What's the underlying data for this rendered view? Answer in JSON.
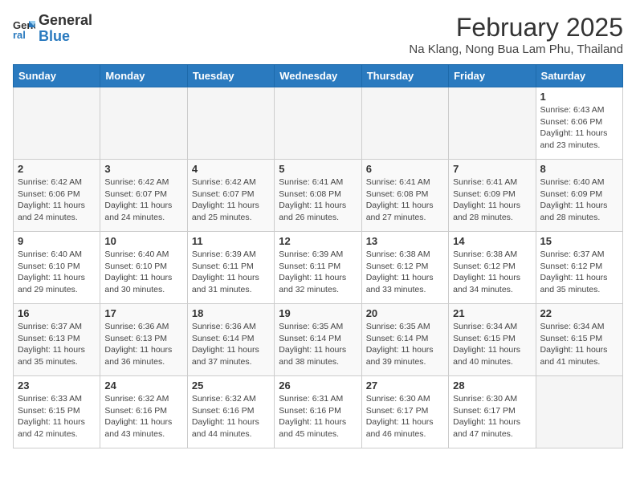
{
  "header": {
    "logo_general": "General",
    "logo_blue": "Blue",
    "month_year": "February 2025",
    "location": "Na Klang, Nong Bua Lam Phu, Thailand"
  },
  "weekdays": [
    "Sunday",
    "Monday",
    "Tuesday",
    "Wednesday",
    "Thursday",
    "Friday",
    "Saturday"
  ],
  "weeks": [
    [
      {
        "day": "",
        "info": ""
      },
      {
        "day": "",
        "info": ""
      },
      {
        "day": "",
        "info": ""
      },
      {
        "day": "",
        "info": ""
      },
      {
        "day": "",
        "info": ""
      },
      {
        "day": "",
        "info": ""
      },
      {
        "day": "1",
        "info": "Sunrise: 6:43 AM\nSunset: 6:06 PM\nDaylight: 11 hours and 23 minutes."
      }
    ],
    [
      {
        "day": "2",
        "info": "Sunrise: 6:42 AM\nSunset: 6:06 PM\nDaylight: 11 hours and 24 minutes."
      },
      {
        "day": "3",
        "info": "Sunrise: 6:42 AM\nSunset: 6:07 PM\nDaylight: 11 hours and 24 minutes."
      },
      {
        "day": "4",
        "info": "Sunrise: 6:42 AM\nSunset: 6:07 PM\nDaylight: 11 hours and 25 minutes."
      },
      {
        "day": "5",
        "info": "Sunrise: 6:41 AM\nSunset: 6:08 PM\nDaylight: 11 hours and 26 minutes."
      },
      {
        "day": "6",
        "info": "Sunrise: 6:41 AM\nSunset: 6:08 PM\nDaylight: 11 hours and 27 minutes."
      },
      {
        "day": "7",
        "info": "Sunrise: 6:41 AM\nSunset: 6:09 PM\nDaylight: 11 hours and 28 minutes."
      },
      {
        "day": "8",
        "info": "Sunrise: 6:40 AM\nSunset: 6:09 PM\nDaylight: 11 hours and 28 minutes."
      }
    ],
    [
      {
        "day": "9",
        "info": "Sunrise: 6:40 AM\nSunset: 6:10 PM\nDaylight: 11 hours and 29 minutes."
      },
      {
        "day": "10",
        "info": "Sunrise: 6:40 AM\nSunset: 6:10 PM\nDaylight: 11 hours and 30 minutes."
      },
      {
        "day": "11",
        "info": "Sunrise: 6:39 AM\nSunset: 6:11 PM\nDaylight: 11 hours and 31 minutes."
      },
      {
        "day": "12",
        "info": "Sunrise: 6:39 AM\nSunset: 6:11 PM\nDaylight: 11 hours and 32 minutes."
      },
      {
        "day": "13",
        "info": "Sunrise: 6:38 AM\nSunset: 6:12 PM\nDaylight: 11 hours and 33 minutes."
      },
      {
        "day": "14",
        "info": "Sunrise: 6:38 AM\nSunset: 6:12 PM\nDaylight: 11 hours and 34 minutes."
      },
      {
        "day": "15",
        "info": "Sunrise: 6:37 AM\nSunset: 6:12 PM\nDaylight: 11 hours and 35 minutes."
      }
    ],
    [
      {
        "day": "16",
        "info": "Sunrise: 6:37 AM\nSunset: 6:13 PM\nDaylight: 11 hours and 35 minutes."
      },
      {
        "day": "17",
        "info": "Sunrise: 6:36 AM\nSunset: 6:13 PM\nDaylight: 11 hours and 36 minutes."
      },
      {
        "day": "18",
        "info": "Sunrise: 6:36 AM\nSunset: 6:14 PM\nDaylight: 11 hours and 37 minutes."
      },
      {
        "day": "19",
        "info": "Sunrise: 6:35 AM\nSunset: 6:14 PM\nDaylight: 11 hours and 38 minutes."
      },
      {
        "day": "20",
        "info": "Sunrise: 6:35 AM\nSunset: 6:14 PM\nDaylight: 11 hours and 39 minutes."
      },
      {
        "day": "21",
        "info": "Sunrise: 6:34 AM\nSunset: 6:15 PM\nDaylight: 11 hours and 40 minutes."
      },
      {
        "day": "22",
        "info": "Sunrise: 6:34 AM\nSunset: 6:15 PM\nDaylight: 11 hours and 41 minutes."
      }
    ],
    [
      {
        "day": "23",
        "info": "Sunrise: 6:33 AM\nSunset: 6:15 PM\nDaylight: 11 hours and 42 minutes."
      },
      {
        "day": "24",
        "info": "Sunrise: 6:32 AM\nSunset: 6:16 PM\nDaylight: 11 hours and 43 minutes."
      },
      {
        "day": "25",
        "info": "Sunrise: 6:32 AM\nSunset: 6:16 PM\nDaylight: 11 hours and 44 minutes."
      },
      {
        "day": "26",
        "info": "Sunrise: 6:31 AM\nSunset: 6:16 PM\nDaylight: 11 hours and 45 minutes."
      },
      {
        "day": "27",
        "info": "Sunrise: 6:30 AM\nSunset: 6:17 PM\nDaylight: 11 hours and 46 minutes."
      },
      {
        "day": "28",
        "info": "Sunrise: 6:30 AM\nSunset: 6:17 PM\nDaylight: 11 hours and 47 minutes."
      },
      {
        "day": "",
        "info": ""
      }
    ]
  ]
}
